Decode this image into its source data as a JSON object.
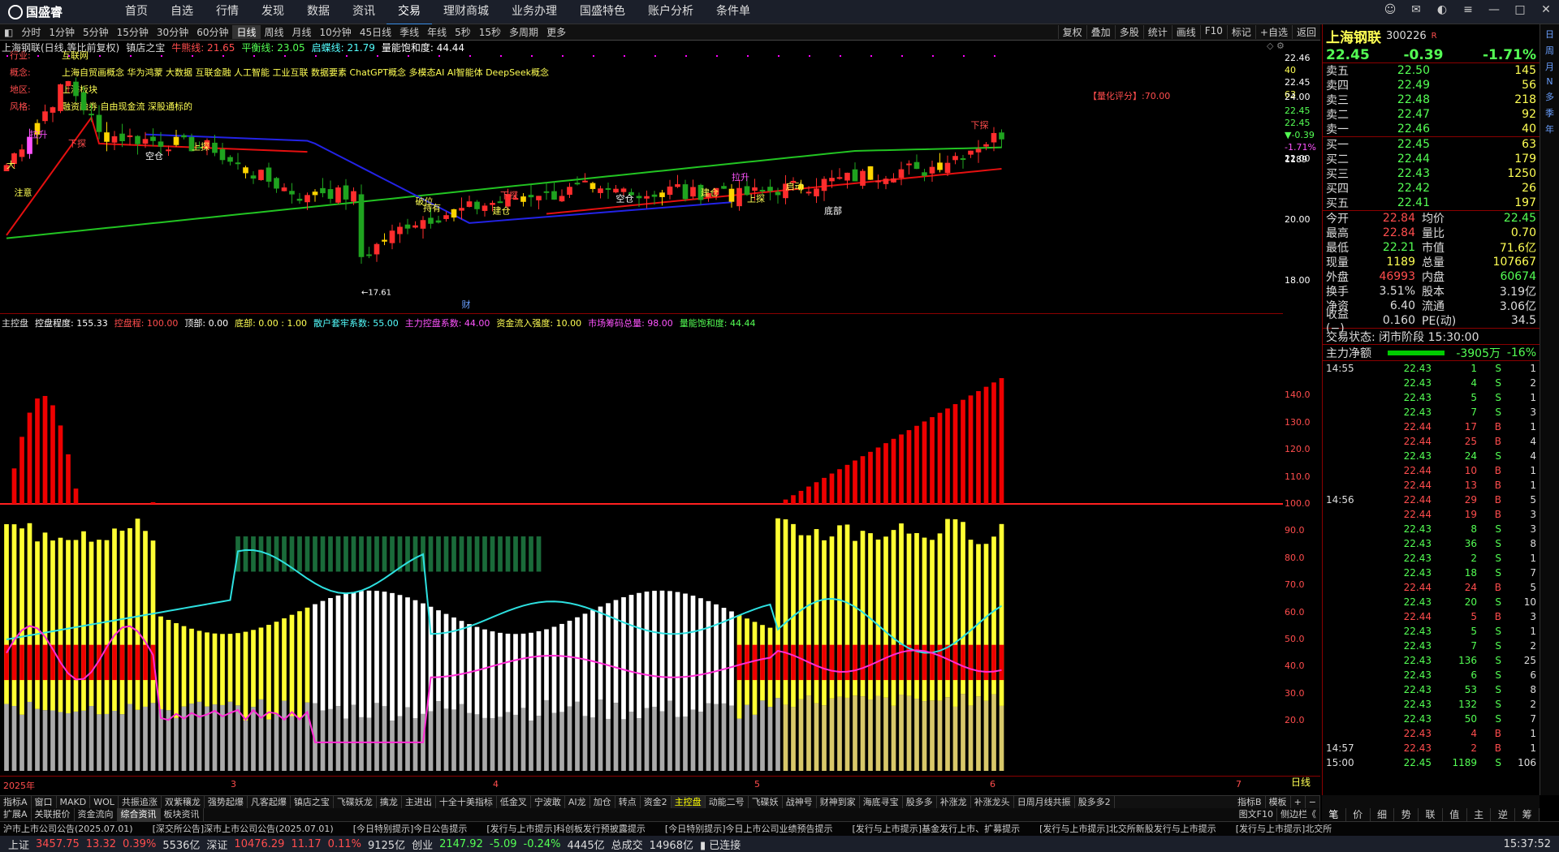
{
  "app": {
    "brand": "国盛睿",
    "menu": [
      "首页",
      "自选",
      "行情",
      "发现",
      "数据",
      "资讯",
      "交易",
      "理财商城",
      "业务办理",
      "国盛特色",
      "账户分析",
      "条件单"
    ],
    "active_menu": "交易"
  },
  "period_bar": {
    "items": [
      "分时",
      "1分钟",
      "5分钟",
      "15分钟",
      "30分钟",
      "60分钟",
      "日线",
      "周线",
      "月线",
      "10分钟",
      "45日线",
      "季线",
      "年线",
      "5秒",
      "15秒",
      "多周期",
      "更多"
    ],
    "active": "日线",
    "right": [
      "复权",
      "叠加",
      "多股",
      "统计",
      "画线",
      "F10",
      "标记",
      "+自选",
      "返回"
    ]
  },
  "chart_header": {
    "title": "上海钢联(日线,等比前复权)",
    "indicator": "镇店之宝",
    "items": [
      {
        "t": "牛熊线: 21.65",
        "c": "#ff4d4d"
      },
      {
        "t": "平衡线: 23.05",
        "c": "#54ff54"
      },
      {
        "t": "启蝶线: 21.79",
        "c": "#54ffff"
      },
      {
        "t": "量能饱和度: 44.44",
        "c": "#fff"
      }
    ]
  },
  "info": {
    "industry_label": "行业:",
    "industry": "互联网",
    "concept_label": "概念:",
    "concept": "上海自贸画概念 华为鸿蒙 大数据 互联金融 人工智能 工业互联 数据要素 ChatGPT概念 多模态AI AI智能体 DeepSeek概念",
    "region_label": "地区:",
    "region": "上海板块",
    "style_label": "风格:",
    "style": "融资融券 自由现金流 深股通标的",
    "score": "【量化评分】:70.00"
  },
  "price_axis": {
    "ticks": [
      "24.00",
      "22.00",
      "20.00",
      "18.00"
    ],
    "top_labels": [
      "22.46",
      "40",
      "22.45",
      "63",
      "22.45",
      "22.45",
      "▼-0.39",
      "-1.71%",
      "1189"
    ]
  },
  "annotations": {
    "low": "←17.61",
    "caption": "财",
    "signals": [
      "下探",
      "下探",
      "上探",
      "下探",
      "上探",
      "空仓",
      "空仓",
      "建仓",
      "建仓",
      "破位",
      "持有",
      "启动",
      "底部",
      "拉升",
      "拉升",
      "注意",
      "大"
    ]
  },
  "ind_header": {
    "title": "主控盘",
    "items": [
      {
        "t": "控盘程度: 155.33",
        "c": "#fff"
      },
      {
        "t": "控盘程: 100.00",
        "c": "#ff4d4d"
      },
      {
        "t": "顶部: 0.00",
        "c": "#fff"
      },
      {
        "t": "底部: 0.00 : 1.00",
        "c": "#ffff54"
      },
      {
        "t": "散户套牢系数: 55.00",
        "c": "#54ffff"
      },
      {
        "t": "主力控盘系数: 44.00",
        "c": "#ff54ff"
      },
      {
        "t": "资金流入强度: 10.00",
        "c": "#ffff54"
      },
      {
        "t": "市场筹码总量: 98.00",
        "c": "#ff54ff"
      },
      {
        "t": "量能饱和度: 44.44",
        "c": "#54ff54"
      }
    ]
  },
  "ind_axis": {
    "ticks": [
      "140.0",
      "130.0",
      "120.0",
      "110.0",
      "100.0",
      "90.0",
      "80.0",
      "70.0",
      "60.0",
      "50.0",
      "40.0",
      "30.0",
      "20.0"
    ]
  },
  "x_axis": {
    "labels": [
      "2025年",
      "3",
      "4",
      "5",
      "6",
      "7"
    ],
    "right": "日线"
  },
  "bottom_tabs": [
    "指标A",
    "窗口",
    "MAKD",
    "WOL",
    "共振追涨",
    "双紫穰龙",
    "强势起爆",
    "凡客起爆",
    "镇店之宝",
    "飞碟妖龙",
    "擒龙",
    "主进出",
    "十全十美指标",
    "低金叉",
    "宁波敢",
    "AI龙",
    "加仓",
    "转点",
    "资金2",
    "主控盘",
    "动能二号",
    "飞碟妖",
    "战神号",
    "财神到家",
    "海底寻宝",
    "股多多",
    "补涨龙",
    "补涨龙头",
    "日周月线共振",
    "股多多2"
  ],
  "bottom_tabs_active": "主控盘",
  "bottom_tabs_right": [
    "指标B",
    "模板",
    "+",
    "−"
  ],
  "bottom_tabs2": [
    "扩展A",
    "关联报价",
    "资金流向",
    "综合资讯",
    "板块资讯"
  ],
  "bottom_tabs2_active": "综合资讯",
  "bottom_tabs2_right": [
    "图文F10",
    "侧边栏《"
  ],
  "stock": {
    "name": "上海钢联",
    "code": "300226",
    "mark": "R",
    "price": "22.45",
    "change": "-0.39",
    "pct": "-1.71%"
  },
  "orderbook": {
    "sell": [
      [
        "卖五",
        "22.50",
        "145"
      ],
      [
        "卖四",
        "22.49",
        "56"
      ],
      [
        "卖三",
        "22.48",
        "218"
      ],
      [
        "卖二",
        "22.47",
        "92"
      ],
      [
        "卖一",
        "22.46",
        "40"
      ]
    ],
    "buy": [
      [
        "买一",
        "22.45",
        "63"
      ],
      [
        "买二",
        "22.44",
        "179"
      ],
      [
        "买三",
        "22.43",
        "1250"
      ],
      [
        "买四",
        "22.42",
        "26"
      ],
      [
        "买五",
        "22.41",
        "197"
      ]
    ]
  },
  "stats": [
    [
      "今开",
      "22.84",
      "均价",
      "22.45"
    ],
    [
      "最高",
      "22.84",
      "量比",
      "0.70"
    ],
    [
      "最低",
      "22.21",
      "市值",
      "71.6亿"
    ],
    [
      "现量",
      "1189",
      "总量",
      "107667"
    ],
    [
      "外盘",
      "46993",
      "内盘",
      "60674"
    ],
    [
      "换手",
      "3.51%",
      "股本",
      "3.19亿"
    ],
    [
      "净资",
      "6.40",
      "流通",
      "3.06亿"
    ],
    [
      "收益(−)",
      "0.160",
      "PE(动)",
      "34.5"
    ]
  ],
  "trade_status": "交易状态: 闭市阶段 15:30:00",
  "main_net": {
    "label": "主力净额",
    "value": "-3905万",
    "pct": "-16%"
  },
  "ticks": [
    [
      "14:55",
      "22.43",
      "1",
      "S",
      "1"
    ],
    [
      "",
      "22.43",
      "4",
      "S",
      "2"
    ],
    [
      "",
      "22.43",
      "5",
      "S",
      "1"
    ],
    [
      "",
      "22.43",
      "7",
      "S",
      "3"
    ],
    [
      "",
      "22.44",
      "17",
      "B",
      "1"
    ],
    [
      "",
      "22.44",
      "25",
      "B",
      "4"
    ],
    [
      "",
      "22.43",
      "24",
      "S",
      "4"
    ],
    [
      "",
      "22.44",
      "10",
      "B",
      "1"
    ],
    [
      "",
      "22.44",
      "13",
      "B",
      "1"
    ],
    [
      "14:56",
      "22.44",
      "29",
      "B",
      "5"
    ],
    [
      "",
      "22.44",
      "19",
      "B",
      "3"
    ],
    [
      "",
      "22.43",
      "8",
      "S",
      "3"
    ],
    [
      "",
      "22.43",
      "36",
      "S",
      "8"
    ],
    [
      "",
      "22.43",
      "2",
      "S",
      "1"
    ],
    [
      "",
      "22.43",
      "18",
      "S",
      "7"
    ],
    [
      "",
      "22.44",
      "24",
      "B",
      "5"
    ],
    [
      "",
      "22.43",
      "20",
      "S",
      "10"
    ],
    [
      "",
      "22.44",
      "5",
      "B",
      "3"
    ],
    [
      "",
      "22.43",
      "5",
      "S",
      "1"
    ],
    [
      "",
      "22.43",
      "7",
      "S",
      "2"
    ],
    [
      "",
      "22.43",
      "136",
      "S",
      "25"
    ],
    [
      "",
      "22.43",
      "6",
      "S",
      "6"
    ],
    [
      "",
      "22.43",
      "53",
      "S",
      "8"
    ],
    [
      "",
      "22.43",
      "132",
      "S",
      "2"
    ],
    [
      "",
      "22.43",
      "50",
      "S",
      "7"
    ],
    [
      "",
      "22.43",
      "4",
      "B",
      "1"
    ],
    [
      "14:57",
      "22.43",
      "2",
      "B",
      "1"
    ],
    [
      "15:00",
      "22.45",
      "1189",
      "S",
      "106"
    ]
  ],
  "right_tabs": [
    "笔",
    "价",
    "细",
    "势",
    "联",
    "值",
    "主",
    "逆",
    "筹"
  ],
  "sidebar": [
    "日",
    "周",
    "月",
    "N",
    "多",
    "季",
    "年"
  ],
  "news": [
    "沪市上市公司公告(2025.07.01)",
    "[深交所公告]深市上市公司公告(2025.07.01)",
    "[今日特别提示]今日公告提示",
    "[发行与上市提示]科创板发行预披露提示",
    "[今日特别提示]今日上市公司业绩预告提示",
    "[发行与上市提示]基金发行上市、扩募提示",
    "[发行与上市提示]北交所新股发行与上市提示",
    "[发行与上市提示]北交所"
  ],
  "status": {
    "sh_label": "上证",
    "sh": "3457.75",
    "sh_chg": "13.32",
    "sh_pct": "0.39%",
    "sh_amt": "5536亿",
    "sz_label": "深证",
    "sz": "10476.29",
    "sz_chg": "11.17",
    "sz_pct": "0.11%",
    "sz_amt": "9125亿",
    "cy_label": "创业",
    "cy": "2147.92",
    "cy_chg": "-5.09",
    "cy_pct": "-0.24%",
    "cy_amt": "4445亿",
    "total_label": "总成交",
    "total": "14968亿",
    "conn": "已连接",
    "time": "15:37:52"
  },
  "chart_data": {
    "type": "candlestick",
    "count": 130,
    "y_range": [
      17.0,
      25.5
    ],
    "low_marker": 17.61,
    "indicator_range": [
      0,
      155
    ]
  }
}
